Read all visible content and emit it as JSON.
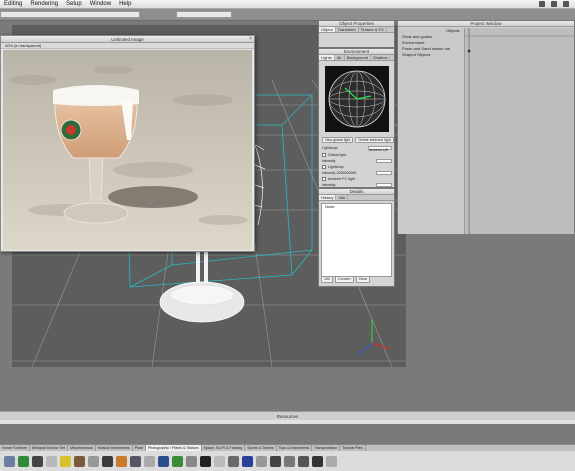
{
  "menubar": {
    "items": [
      "Editing",
      "Rendering",
      "Setup",
      "Window",
      "Help"
    ]
  },
  "render_window": {
    "title": "Unlimited Image",
    "subtitle": "40% (in transparent)"
  },
  "object_properties": {
    "title": "Object Properties",
    "tabs": [
      "Object",
      "Transform",
      "Texture & FX"
    ]
  },
  "environment": {
    "title": "Environment",
    "tabs": [
      "Lights",
      "Air",
      "Background",
      "Shadow"
    ],
    "add_light_label": "New global light",
    "delete_light_label": "Delete selected light",
    "light_dropdown_label": "Lightshop",
    "light_dropdown_value": "Ambient UE",
    "rows": [
      {
        "label": "Global light"
      },
      {
        "label": "Intensity"
      },
      {
        "label": "Lightshop"
      },
      {
        "label": "Intensity  1000000000"
      },
      {
        "label": "Ambient PC light"
      },
      {
        "label": "Intensity"
      }
    ]
  },
  "details": {
    "title": "Details",
    "tabs": [
      "History",
      "Info"
    ],
    "list_items": [
      "Node"
    ],
    "footer_buttons": [
      "100",
      "Convert",
      "Clear"
    ]
  },
  "project_window": {
    "title": "Project Window",
    "objects_label": "Objects",
    "items": [
      "Grids and guides",
      "Environment",
      "Poser and Sand shown me",
      "Shaped Objects"
    ]
  },
  "status_bar": {
    "text": "Resources"
  },
  "content_tabs": {
    "items": [
      "Home Furniture",
      "Metapad Erector Set",
      "Miscellaneous",
      "Musical Instruments",
      "Plant",
      "Photographic / Plants & Statues",
      "Space, Sci-Fi & Fantasy",
      "Sports & Games",
      "Toys & Instruments",
      "Transportation",
      "Tutorial Files"
    ]
  },
  "colors": {
    "viewport_bg": "#5d5d5d",
    "grid": "#9a9a9a",
    "panel_bg": "#d4d4d4",
    "wireframe": "#f2f2f2",
    "bounding_box": "#27b9c4"
  }
}
